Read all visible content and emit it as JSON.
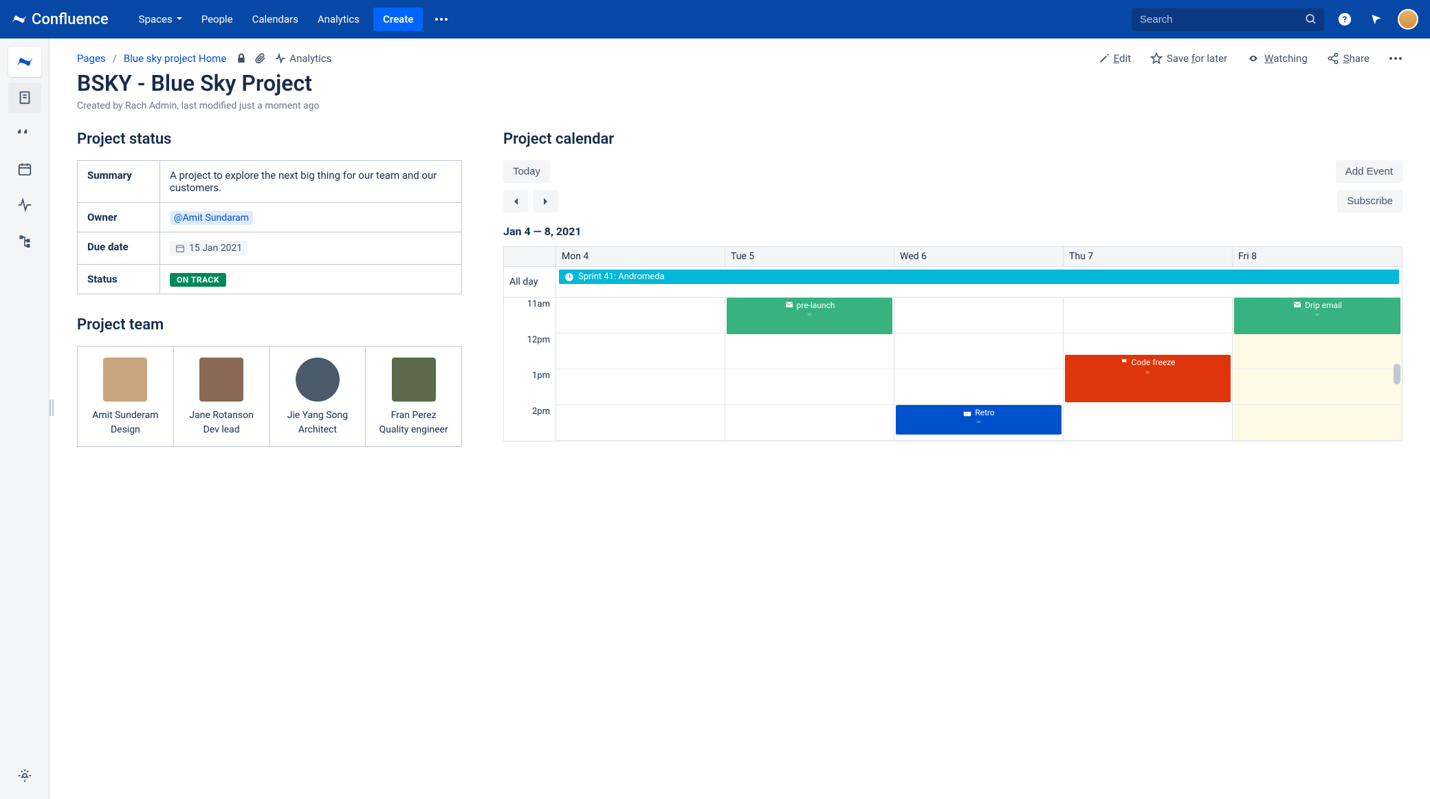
{
  "topnav": {
    "product": "Confluence",
    "items": [
      "Spaces",
      "People",
      "Calendars",
      "Analytics"
    ],
    "create": "Create",
    "search_placeholder": "Search"
  },
  "breadcrumb": {
    "root": "Pages",
    "parent": "Blue sky project Home",
    "analytics": "Analytics"
  },
  "page_actions": {
    "edit": "Edit",
    "save": "Save for later",
    "save_u": "f",
    "watching": "Watching",
    "watching_u": "W",
    "share": "Share",
    "share_u": "S",
    "edit_u": "E"
  },
  "page": {
    "title": "BSKY - Blue Sky Project",
    "meta": "Created by Rach Admin, last modified just a moment ago"
  },
  "sections": {
    "status": "Project status",
    "team": "Project team",
    "calendar": "Project calendar"
  },
  "status_table": {
    "summary_label": "Summary",
    "summary": "A project to explore the next big thing for our team and our customers.",
    "owner_label": "Owner",
    "owner": "@Amit Sundaram",
    "due_label": "Due date",
    "due": "15 Jan 2021",
    "status_label": "Status",
    "status": "ON TRACK"
  },
  "team": [
    {
      "name": "Amit Sunderam",
      "role": "Design",
      "shape": "square",
      "bg": "#c9a57e"
    },
    {
      "name": "Jane Rotanson",
      "role": "Dev lead",
      "shape": "square",
      "bg": "#8a6a56"
    },
    {
      "name": "Jie Yang Song",
      "role": "Architect",
      "shape": "round",
      "bg": "#4a5a6a"
    },
    {
      "name": "Fran Perez",
      "role": "Quality engineer",
      "shape": "square",
      "bg": "#5a6a4a"
    }
  ],
  "calendar": {
    "today_btn": "Today",
    "add_btn": "Add Event",
    "subscribe_btn": "Subscribe",
    "range": "Jan 4 — 8, 2021",
    "allday_label": "All day",
    "days": [
      "Mon 4",
      "Tue 5",
      "Wed 6",
      "Thu 7",
      "Fri 8"
    ],
    "times": [
      "11am",
      "12pm",
      "1pm",
      "2pm"
    ],
    "today_col": 4,
    "allday_event": "Sprint 41: Andromeda",
    "events": [
      {
        "title": "pre-launch",
        "day": 1,
        "start": 0,
        "rows": 1.1,
        "color": "green",
        "icon": "mail"
      },
      {
        "title": "Drip email",
        "day": 4,
        "start": 0,
        "rows": 1.1,
        "color": "green",
        "icon": "mail"
      },
      {
        "title": "Code freeze",
        "day": 3,
        "start": 1.6,
        "rows": 1.4,
        "color": "red",
        "icon": "flag"
      },
      {
        "title": "Retro",
        "day": 2,
        "start": 3,
        "rows": 0.9,
        "color": "blue",
        "icon": "cal"
      }
    ]
  }
}
